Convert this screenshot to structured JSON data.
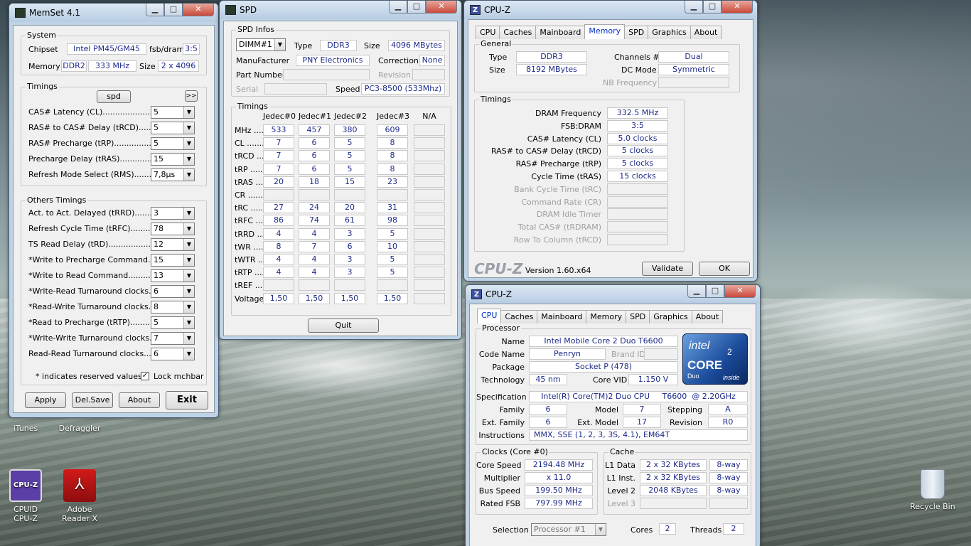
{
  "memset": {
    "title": "MemSet 4.1",
    "system": {
      "label": "System",
      "chipset_label": "Chipset",
      "chipset": "Intel PM45/GM45",
      "fsb_label": "fsb/dram",
      "fsb": "3:5",
      "memory_label": "Memory",
      "memory_type": "DDR2",
      "memory_freq": "333 MHz",
      "size_label": "Size",
      "size": "2 x 4096"
    },
    "timings": {
      "label": "Timings",
      "spd_button": "spd",
      "more_button": ">>",
      "rows": [
        {
          "label": "CAS# Latency (CL)........................",
          "value": "5"
        },
        {
          "label": "RAS# to CAS# Delay (tRCD)..............",
          "value": "5"
        },
        {
          "label": "RAS# Precharge (tRP)........................",
          "value": "5"
        },
        {
          "label": "Precharge Delay  (tRAS)......................",
          "value": "15"
        },
        {
          "label": "Refresh Mode Select (RMS)..............",
          "value": "7,8µs"
        }
      ]
    },
    "others": {
      "label": "Others Timings",
      "rows": [
        {
          "label": "Act. to Act. Delayed (tRRD)..............",
          "value": "3"
        },
        {
          "label": "Refresh Cycle Time (tRFC)................",
          "value": "78"
        },
        {
          "label": "TS Read Delay (tRD)............................",
          "value": "12"
        },
        {
          "label": "*Write to Precharge Command.........",
          "value": "15"
        },
        {
          "label": "*Write to Read Command...................",
          "value": "13"
        },
        {
          "label": "*Write-Read Turnaround clocks.........",
          "value": "6"
        },
        {
          "label": "*Read-Write Turnaround clocks.........",
          "value": "8"
        },
        {
          "label": "*Read to Precharge (tRTP)...............",
          "value": "5"
        },
        {
          "label": "*Write-Write Turnaround clocks.........",
          "value": "7"
        },
        {
          "label": "Read-Read Turnaround clocks..........",
          "value": "6"
        }
      ],
      "note": "* indicates reserved values",
      "lock_label": "Lock mchbar",
      "lock_checked": true
    },
    "buttons": {
      "apply": "Apply",
      "delsave": "Del.Save",
      "about": "About",
      "exit": "Exit"
    }
  },
  "spd": {
    "title": "SPD",
    "infos": {
      "label": "SPD Infos",
      "slot": "DIMM#1",
      "type_label": "Type",
      "type": "DDR3",
      "size_label": "Size",
      "size": "4096 MBytes",
      "manufacturer_label": "ManuFacturer",
      "manufacturer": "PNY Electronics",
      "correction_label": "Correction",
      "correction": "None",
      "partnumber_label": "Part Number",
      "revision_label": "Revision",
      "serial_label": "Serial",
      "speed_label": "Speed",
      "speed": "PC3-8500 (533Mhz)"
    },
    "timings": {
      "label": "Timings",
      "headers": [
        "Jedec#0",
        "Jedec#1",
        "Jedec#2",
        "Jedec#3",
        "N/A"
      ],
      "rows": [
        {
          "label": "MHz .......",
          "values": [
            "533",
            "457",
            "380",
            "609",
            ""
          ]
        },
        {
          "label": "CL ..........",
          "values": [
            "7",
            "6",
            "5",
            "8",
            ""
          ]
        },
        {
          "label": "tRCD .......",
          "values": [
            "7",
            "6",
            "5",
            "8",
            ""
          ]
        },
        {
          "label": "tRP ........",
          "values": [
            "7",
            "6",
            "5",
            "8",
            ""
          ]
        },
        {
          "label": "tRAS .......",
          "values": [
            "20",
            "18",
            "15",
            "23",
            ""
          ]
        },
        {
          "label": "CR ..........",
          "values": [
            "",
            "",
            "",
            "",
            ""
          ]
        },
        {
          "label": "tRC .........",
          "values": [
            "27",
            "24",
            "20",
            "31",
            ""
          ]
        },
        {
          "label": "tRFC .......",
          "values": [
            "86",
            "74",
            "61",
            "98",
            ""
          ]
        },
        {
          "label": "tRRD .......",
          "values": [
            "4",
            "4",
            "3",
            "5",
            ""
          ]
        },
        {
          "label": "tWR ........",
          "values": [
            "8",
            "7",
            "6",
            "10",
            ""
          ]
        },
        {
          "label": "tWTR .......",
          "values": [
            "4",
            "4",
            "3",
            "5",
            ""
          ]
        },
        {
          "label": "tRTP .......",
          "values": [
            "4",
            "4",
            "3",
            "5",
            ""
          ]
        },
        {
          "label": "tREF ........",
          "values": [
            "",
            "",
            "",
            "",
            ""
          ]
        },
        {
          "label": "Voltage",
          "values": [
            "1,50",
            "1,50",
            "1,50",
            "1,50",
            ""
          ]
        }
      ]
    },
    "quit": "Quit"
  },
  "cpuz_mem": {
    "title": "CPU-Z",
    "tabs": [
      "CPU",
      "Caches",
      "Mainboard",
      "Memory",
      "SPD",
      "Graphics",
      "About"
    ],
    "active_tab": "Memory",
    "general": {
      "label": "General",
      "type_label": "Type",
      "type": "DDR3",
      "size_label": "Size",
      "size": "8192 MBytes",
      "channels_label": "Channels #",
      "channels": "Dual",
      "dcmode_label": "DC Mode",
      "dcmode": "Symmetric",
      "nbfreq_label": "NB Frequency"
    },
    "timings": {
      "label": "Timings",
      "rows": [
        {
          "label": "DRAM Frequency",
          "value": "332.5 MHz",
          "enabled": true
        },
        {
          "label": "FSB:DRAM",
          "value": "3:5",
          "enabled": true
        },
        {
          "label": "CAS# Latency (CL)",
          "value": "5.0 clocks",
          "enabled": true
        },
        {
          "label": "RAS# to CAS# Delay (tRCD)",
          "value": "5 clocks",
          "enabled": true
        },
        {
          "label": "RAS# Precharge (tRP)",
          "value": "5 clocks",
          "enabled": true
        },
        {
          "label": "Cycle Time (tRAS)",
          "value": "15 clocks",
          "enabled": true
        },
        {
          "label": "Bank Cycle Time (tRC)",
          "value": "",
          "enabled": false
        },
        {
          "label": "Command Rate (CR)",
          "value": "",
          "enabled": false
        },
        {
          "label": "DRAM Idle Timer",
          "value": "",
          "enabled": false
        },
        {
          "label": "Total CAS# (tRDRAM)",
          "value": "",
          "enabled": false
        },
        {
          "label": "Row To Column (tRCD)",
          "value": "",
          "enabled": false
        }
      ]
    },
    "logo": "CPU-Z",
    "version": "Version 1.60.x64",
    "validate": "Validate",
    "ok": "OK"
  },
  "cpuz_cpu": {
    "title": "CPU-Z",
    "tabs": [
      "CPU",
      "Caches",
      "Mainboard",
      "Memory",
      "SPD",
      "Graphics",
      "About"
    ],
    "active_tab": "CPU",
    "processor": {
      "label": "Processor",
      "name_label": "Name",
      "name": "Intel Mobile Core 2 Duo T6600",
      "codename_label": "Code Name",
      "codename": "Penryn",
      "brandid_label": "Brand ID",
      "package_label": "Package",
      "package": "Socket P (478)",
      "tech_label": "Technology",
      "tech": "45 nm",
      "corevid_label": "Core VID",
      "corevid": "1.150 V",
      "spec_label": "Specification",
      "spec": "Intel(R) Core(TM)2 Duo CPU     T6600  @ 2.20GHz",
      "family_label": "Family",
      "family": "6",
      "model_label": "Model",
      "model": "7",
      "stepping_label": "Stepping",
      "stepping": "A",
      "extfamily_label": "Ext. Family",
      "extfamily": "6",
      "extmodel_label": "Ext. Model",
      "extmodel": "17",
      "revision_label": "Revision",
      "revision": "R0",
      "instr_label": "Instructions",
      "instr": "MMX, SSE (1, 2, 3, 3S, 4.1), EM64T"
    },
    "badge": {
      "brand": "intel",
      "line": "CORE",
      "num": "2",
      "sub": "Duo",
      "tag": "inside"
    },
    "clocks": {
      "label": "Clocks (Core #0)",
      "corespeed_label": "Core Speed",
      "corespeed": "2194.48 MHz",
      "mult_label": "Multiplier",
      "mult": "x 11.0",
      "bus_label": "Bus Speed",
      "bus": "199.50 MHz",
      "fsb_label": "Rated FSB",
      "fsb": "797.99 MHz"
    },
    "cache": {
      "label": "Cache",
      "rows": [
        {
          "label": "L1 Data",
          "size": "2 x 32 KBytes",
          "way": "8-way",
          "enabled": true
        },
        {
          "label": "L1 Inst.",
          "size": "2 x 32 KBytes",
          "way": "8-way",
          "enabled": true
        },
        {
          "label": "Level 2",
          "size": "2048 KBytes",
          "way": "8-way",
          "enabled": true
        },
        {
          "label": "Level 3",
          "size": "",
          "way": "",
          "enabled": false
        }
      ]
    },
    "selection_label": "Selection",
    "selection": "Processor #1",
    "cores_label": "Cores",
    "cores": "2",
    "threads_label": "Threads",
    "threads": "2"
  },
  "desktop": {
    "icons": [
      {
        "label": "iTunes"
      },
      {
        "label": "Defraggler"
      },
      {
        "label": "CPUID\nCPU-Z"
      },
      {
        "label": "Adobe\nReader X"
      },
      {
        "label": "Recycle Bin"
      }
    ]
  }
}
